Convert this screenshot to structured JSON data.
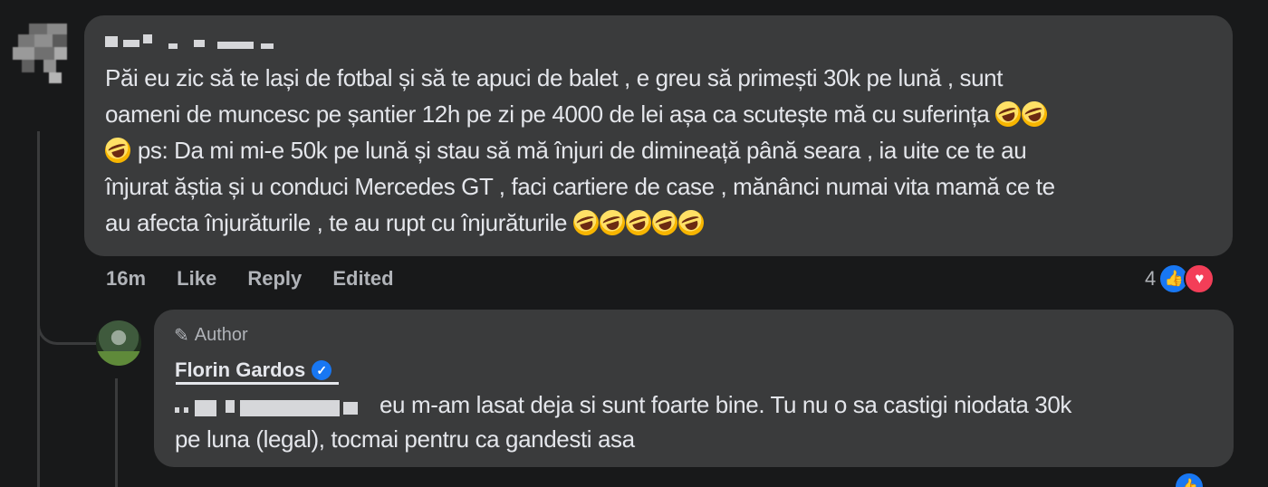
{
  "comment": {
    "text_lines": [
      "Păi eu zic să te lași de fotbal și să te apuci de balet , e greu să primești 30k pe lună , sunt",
      "oameni de muncesc pe șantier 12h pe zi pe 4000 de lei așa ca scutește mă cu suferința",
      "ps: Da mi mi-e 50k pe lună și stau să mă înjuri de dimineață până seara , ia uite ce te au",
      "înjurat ăștia și u conduci Mercedes GT , faci cartiere de case , mănânci numai vita mamă ce te",
      "au afecta înjurăturile , te au rupt cu înjurăturile"
    ],
    "emoji_name": "rolling-on-the-floor-laughing",
    "time": "16m",
    "like_label": "Like",
    "reply_label": "Reply",
    "edited_label": "Edited",
    "reaction_count": "4",
    "reactions": [
      "like",
      "love"
    ]
  },
  "reply": {
    "badge_label": "Author",
    "author_name": "Florin Gardos",
    "verified": true,
    "text_line_1": "eu m-am lasat deja si sunt foarte bine. Tu nu o sa castigi niodata 30k",
    "text_line_2": "pe luna (legal), tocmai pentru ca gandesti asa"
  },
  "colors": {
    "background": "#18191a",
    "bubble": "#3a3b3c",
    "text": "#e4e6eb",
    "secondary_text": "#b0b3b8",
    "like_blue": "#1877f2",
    "love_red": "#f33e58"
  }
}
